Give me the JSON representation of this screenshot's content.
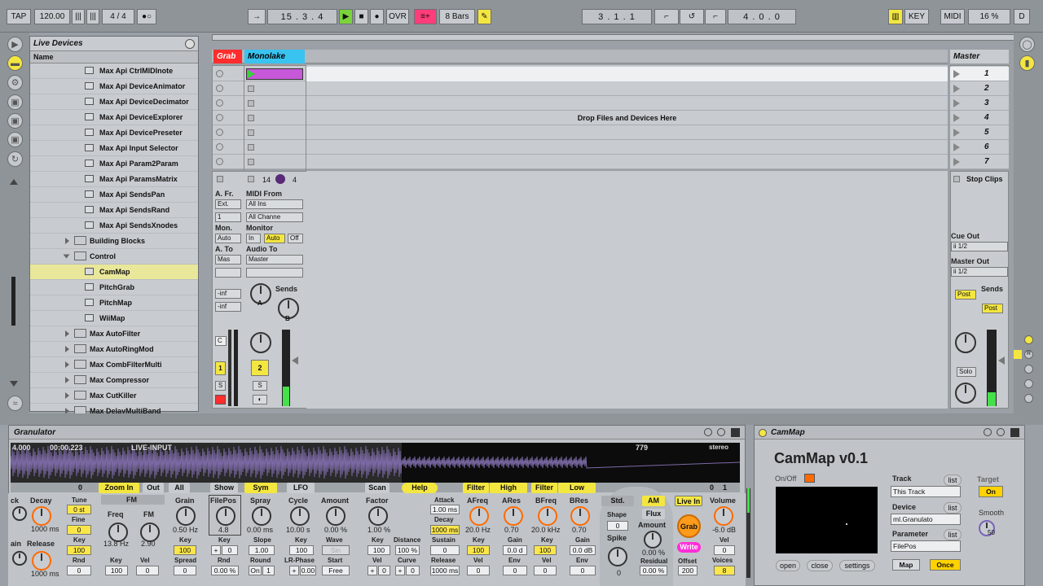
{
  "transport": {
    "tap": "TAP",
    "tempo": "120.00",
    "meter_num": "4",
    "meter_slash": "/",
    "meter_den": "4",
    "position": "15 .  3 .  4",
    "ovr": "OVR",
    "quantize": "8 Bars",
    "loop_start": "3 .  1 .  1",
    "loop_len": "4 .  0 .  0",
    "key": "KEY",
    "midi": "MIDI",
    "cpu": "16 %",
    "d": "D"
  },
  "browser": {
    "title": "Live Devices",
    "column": "Name",
    "items": [
      {
        "label": "Max Api CtrlMIDInote",
        "indent": "item"
      },
      {
        "label": "Max Api DeviceAnimator",
        "indent": "item"
      },
      {
        "label": "Max Api DeviceDecimator",
        "indent": "item"
      },
      {
        "label": "Max Api DeviceExplorer",
        "indent": "item"
      },
      {
        "label": "Max Api DevicePreseter",
        "indent": "item"
      },
      {
        "label": "Max Api Input Selector",
        "indent": "item"
      },
      {
        "label": "Max Api Param2Param",
        "indent": "item"
      },
      {
        "label": "Max Api ParamsMatrix",
        "indent": "item"
      },
      {
        "label": "Max Api SendsPan",
        "indent": "item"
      },
      {
        "label": "Max Api SendsRand",
        "indent": "item"
      },
      {
        "label": "Max Api SendsXnodes",
        "indent": "item"
      },
      {
        "label": "Building Blocks",
        "indent": "folder"
      },
      {
        "label": "Control",
        "indent": "openfolder"
      },
      {
        "label": "CamMap",
        "indent": "sub",
        "selected": true
      },
      {
        "label": "PitchGrab",
        "indent": "sub"
      },
      {
        "label": "PitchMap",
        "indent": "sub"
      },
      {
        "label": "WiiMap",
        "indent": "sub"
      },
      {
        "label": "Max AutoFilter",
        "indent": "folder"
      },
      {
        "label": "Max AutoRingMod",
        "indent": "folder"
      },
      {
        "label": "Max CombFilterMulti",
        "indent": "folder"
      },
      {
        "label": "Max Compressor",
        "indent": "folder"
      },
      {
        "label": "Max CutKiller",
        "indent": "folder"
      },
      {
        "label": "Max DelayMultiBand",
        "indent": "folder"
      }
    ]
  },
  "session": {
    "track1": "Grab",
    "track2": "Monolake",
    "master": "Master",
    "drop_text": "Drop Files and Devices Here",
    "scenes": [
      "1",
      "2",
      "3",
      "4",
      "5",
      "6",
      "7"
    ],
    "stop_clips": "Stop Clips",
    "clip_count": "14",
    "clip_num": "4",
    "io": {
      "afr": "A. Fr.",
      "ext": "Ext.",
      "ch1": "1",
      "midi_from": "MIDI From",
      "all_ins": "All Ins",
      "all_channels": "All Channe",
      "mon": "Mon.",
      "auto": "Auto",
      "monitor": "Monitor",
      "in": "In",
      "auto_btn": "Auto",
      "off": "Off",
      "ato": "A. To",
      "mas": "Mas",
      "audio_to": "Audio To",
      "master_sel": "Master",
      "inf1": "-inf",
      "inf2": "-inf",
      "sends": "Sends",
      "a": "A",
      "b": "B",
      "c": "C",
      "num1": "1",
      "num2": "2",
      "s1": "S",
      "s2": "S"
    },
    "master_io": {
      "cue_out": "Cue Out",
      "cue_val": "ii 1/2",
      "master_out": "Master Out",
      "master_val": "ii 1/2",
      "sends": "Sends",
      "post1": "Post",
      "post2": "Post",
      "solo": "Solo"
    }
  },
  "granulator": {
    "title": "Granulator",
    "time1": "4.000",
    "time2": "00:00.223",
    "live_input": "LIVE-INPUT",
    "count": "779",
    "stereo": "stereo",
    "zoom_in": "Zoom In",
    "out": "Out",
    "all": "All",
    "show": "Show",
    "sym": "Sym",
    "lfo": "LFO",
    "scan": "Scan",
    "help": "Help",
    "filter1": "Filter",
    "high": "High",
    "filter2": "Filter",
    "low": "Low",
    "c0": "0",
    "c1": "0",
    "c2": "1",
    "labels": {
      "ck": "ck",
      "decay": "Decay",
      "ain": "ain",
      "release": "Release",
      "tune": "Tune",
      "fine": "Fine",
      "key": "Key",
      "rnd": "Rnd",
      "fm": "FM",
      "freq": "Freq",
      "fm2": "FM",
      "key2": "Key",
      "vel": "Vel",
      "grain": "Grain",
      "key3": "Key",
      "spread": "Spread",
      "filepos": "FilePos",
      "key4": "Key",
      "rnd2": "Rnd",
      "spray": "Spray",
      "slope": "Slope",
      "round": "Round",
      "cycle": "Cycle",
      "amount": "Amount",
      "key5": "Key",
      "wave": "Wave",
      "lrphase": "LR-Phase",
      "start": "Start",
      "factor": "Factor",
      "key6": "Key",
      "distance": "Distance",
      "vel2": "Vel",
      "curve": "Curve",
      "attack": "Attack",
      "decay2": "Decay",
      "sustain": "Sustain",
      "release2": "Release",
      "afreq": "AFreq",
      "ares": "ARes",
      "key7": "Key",
      "gain": "Gain",
      "vel3": "Vel",
      "env": "Env",
      "bfreq": "BFreq",
      "bres": "BRes",
      "key8": "Key",
      "gain2": "Gain",
      "vel4": "Vel",
      "env2": "Env",
      "std": "Std.",
      "shape": "Shape",
      "spike": "Spike",
      "am": "AM",
      "flux": "Flux",
      "amount2": "Amount",
      "residual": "Residual",
      "livein": "Live In",
      "grab": "Grab",
      "write": "Write",
      "offset": "Offset",
      "volume": "Volume",
      "vel5": "Vel",
      "voices": "Voices"
    },
    "values": {
      "decay": "1000 ms",
      "release": "1000 ms",
      "tune": "0 st",
      "fine": "0",
      "key": "100",
      "rnd": "0",
      "freq": "13.8 Hz",
      "fm": "2.90",
      "keyv": "100",
      "velv": "0",
      "grain": "0.50 Hz",
      "grain_key": "100",
      "spread": "0",
      "filepos": "4.8",
      "fp_key_a": "+",
      "fp_key_b": "0",
      "rnd2": "0.00 %",
      "spray": "0.00 ms",
      "slope": "1.00",
      "round_on": "On",
      "round_v": "1",
      "cycle": "10.00 s",
      "amount": "0.00 %",
      "cyc_key": "100",
      "wave": "Sin",
      "lr_a": "+",
      "lr_b": "0.00",
      "start": "Free",
      "factor": "1.00 %",
      "f_key": "100",
      "f_dist": "100 %",
      "f_vel_a": "+",
      "f_vel_b": "0",
      "f_curve_a": "+",
      "f_curve_b": "0",
      "attack": "1.00 ms",
      "sustain": "0",
      "afreq": "20.0 Hz",
      "ares": "0.70",
      "akey": "100",
      "again": "0.0 d",
      "avel": "0",
      "aenv": "0",
      "bfreq": "20.0 kHz",
      "bres": "0.70",
      "bkey": "100",
      "bgain": "0.0 dB",
      "bvel": "0",
      "benv": "0",
      "shape": "0",
      "spike": "0",
      "residual": "0.00 %",
      "offset": "200",
      "volume": "-6.0 dB",
      "vel": "0",
      "voices": "8"
    }
  },
  "cammap": {
    "title": "CamMap",
    "heading": "CamMap v0.1",
    "onoff": "On/Off",
    "track_lbl": "Track",
    "list1": "list",
    "track_val": "This Track",
    "device_lbl": "Device",
    "list2": "list",
    "device_val": "ml.Granulato",
    "param_lbl": "Parameter",
    "list3": "list",
    "param_val": "FilePos",
    "target": "Target",
    "on": "On",
    "smooth": "Smooth",
    "smooth_val": "50",
    "open": "open",
    "close": "close",
    "settings": "settings",
    "map": "Map",
    "once": "Once"
  }
}
